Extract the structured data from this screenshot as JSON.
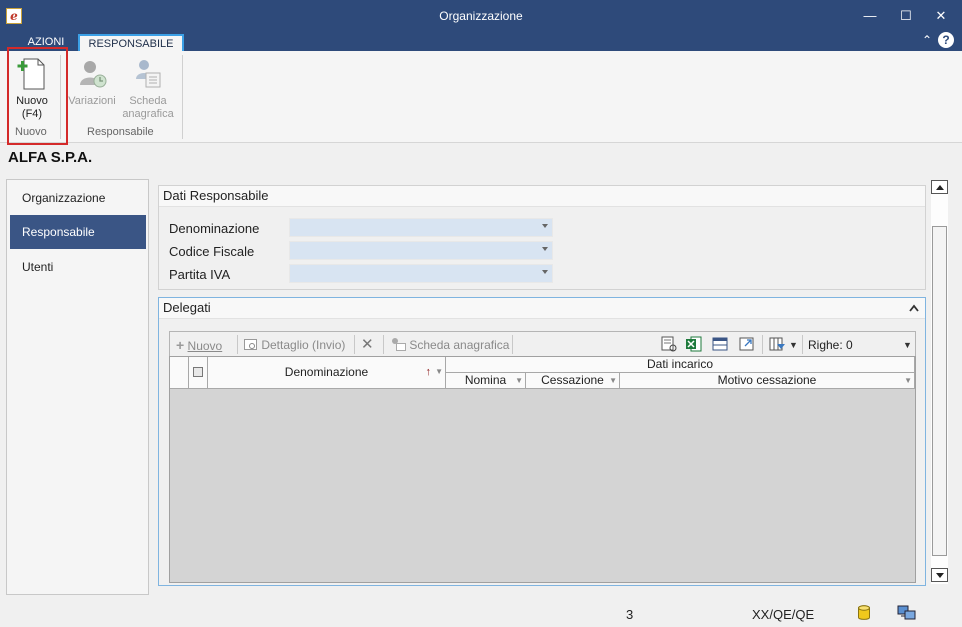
{
  "window": {
    "title": "Organizzazione",
    "app_icon_letter": "e",
    "minimize": "—",
    "maximize": "☐",
    "close": "✕"
  },
  "ribbon_tabs": {
    "tabs": [
      {
        "label": "AZIONI",
        "active": false
      },
      {
        "label": "RESPONSABILE",
        "active": true
      }
    ],
    "collapse_glyph": "⌃",
    "help_glyph": "?"
  },
  "ribbon": {
    "buttons": [
      {
        "label_line1": "Nuovo",
        "label_line2": "(F4)",
        "icon": "new-document-plus-icon",
        "enabled": true
      },
      {
        "label_line1": "Variazioni",
        "label_line2": "",
        "icon": "user-history-icon",
        "enabled": false
      },
      {
        "label_line1": "Scheda",
        "label_line2": "anagrafica",
        "icon": "registry-card-icon",
        "enabled": false
      }
    ],
    "groups": [
      "Nuovo",
      "Responsabile"
    ]
  },
  "company_name": "ALFA S.P.A.",
  "nav": {
    "items": [
      {
        "label": "Organizzazione",
        "active": false
      },
      {
        "label": "Responsabile",
        "active": true
      },
      {
        "label": "Utenti",
        "active": false
      }
    ]
  },
  "dati_responsabile": {
    "title": "Dati Responsabile",
    "fields": [
      {
        "label": "Denominazione",
        "value": ""
      },
      {
        "label": "Codice Fiscale",
        "value": ""
      },
      {
        "label": "Partita IVA",
        "value": ""
      }
    ]
  },
  "delegati": {
    "title": "Delegati",
    "toolbar": {
      "nuovo": "Nuovo",
      "dettaglio": "Dettaglio (Invio)",
      "scheda": "Scheda anagrafica",
      "righe_label": "Righe: 0"
    },
    "grid": {
      "col_denominazione": "Denominazione",
      "group_header": "Dati incarico",
      "col_nomina": "Nomina",
      "col_cessazione": "Cessazione",
      "col_motivo": "Motivo cessazione"
    }
  },
  "status": {
    "count": "3",
    "code": "XX/QE/QE"
  },
  "colors": {
    "titlebar": "#2e4a7a",
    "active_nav": "#3a5585",
    "tab_border": "#3ba0e6",
    "highlight": "#d42a2a",
    "combo_fill": "#d8e4f2"
  }
}
